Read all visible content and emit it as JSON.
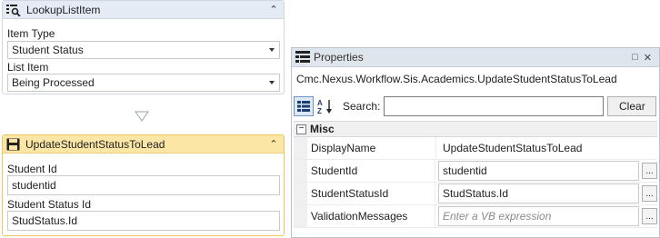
{
  "lookup_activity": {
    "title": "LookupListItem",
    "item_type_label": "Item Type",
    "item_type_value": "Student Status",
    "list_item_label": "List Item",
    "list_item_value": "Being Processed"
  },
  "update_activity": {
    "title": "UpdateStudentStatusToLead",
    "student_id_label": "Student Id",
    "student_id_value": "studentid",
    "student_status_id_label": "Student Status Id",
    "student_status_id_value": "StudStatus.Id"
  },
  "properties": {
    "title": "Properties",
    "type_name": "Cmc.Nexus.Workflow.Sis.Academics.UpdateStudentStatusToLead",
    "search_label": "Search:",
    "search_value": "",
    "clear_label": "Clear",
    "category": "Misc",
    "rows": [
      {
        "name": "DisplayName",
        "value": "UpdateStudentStatusToLead"
      },
      {
        "name": "StudentId",
        "value": "studentid"
      },
      {
        "name": "StudentStatusId",
        "value": "StudStatus.Id"
      },
      {
        "name": "ValidationMessages",
        "placeholder": "Enter a VB expression"
      }
    ]
  },
  "colors": {
    "selected_header": "#fbe6a6",
    "selected_border": "#f0c45c",
    "normal_header": "#e4ebf5"
  }
}
